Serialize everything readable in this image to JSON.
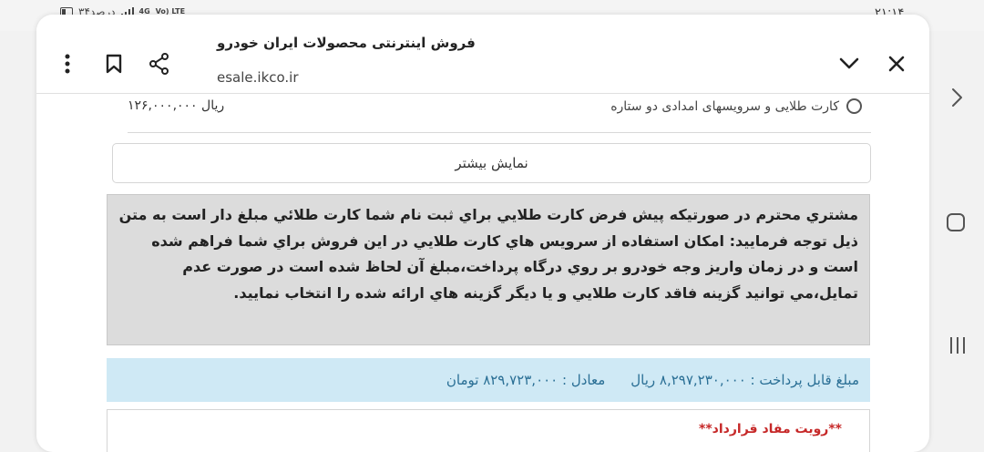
{
  "status_bar": {
    "battery_text": "۳۴درصد",
    "network_label": "4G",
    "volte_label": "Vo) LTE",
    "clock": "۲۱:۱۴"
  },
  "browser": {
    "page_title": "فروش اینترنتی محصولات ایران خودرو",
    "url": "esale.ikco.ir"
  },
  "option": {
    "price": "۱۲۶,۰۰۰,۰۰۰ ريال",
    "label": "کارت طلایی و سرویسهای امدادی دو ستاره"
  },
  "show_more_label": "نمایش بیشتر",
  "notice": {
    "text": "مشتري محترم در صورتيكه پيش فرض كارت طلايي براي ثبت نام شما كارت طلائي مبلغ دار است به متن ذيل توجه فرماييد: امكان استفاده از سرويس هاي كارت طلايي در اين فروش براي شما فراهم شده است و در زمان واريز وجه خودرو بر روي درگاه پرداخت،مبلغ آن لحاظ شده است در صورت عدم تمايل،مي توانيد گزينه فاقد كارت طلايي و يا ديگر گزينه هاي ارائه شده را انتخاب نماييد."
  },
  "payment": {
    "amount_text": "مبلغ قابل پرداخت : ۸,۲۹۷,۲۳۰,۰۰۰ ريال",
    "equivalent_text": "معادل : ۸۲۹,۷۲۳,۰۰۰ تومان"
  },
  "contract": {
    "title": "**رویت مفاد قرارداد**"
  },
  "colors": {
    "payment_bg": "#cfe9f5",
    "payment_text": "#2a6f95",
    "notice_bg": "#dcdcdc",
    "contract_title": "#c62828"
  }
}
